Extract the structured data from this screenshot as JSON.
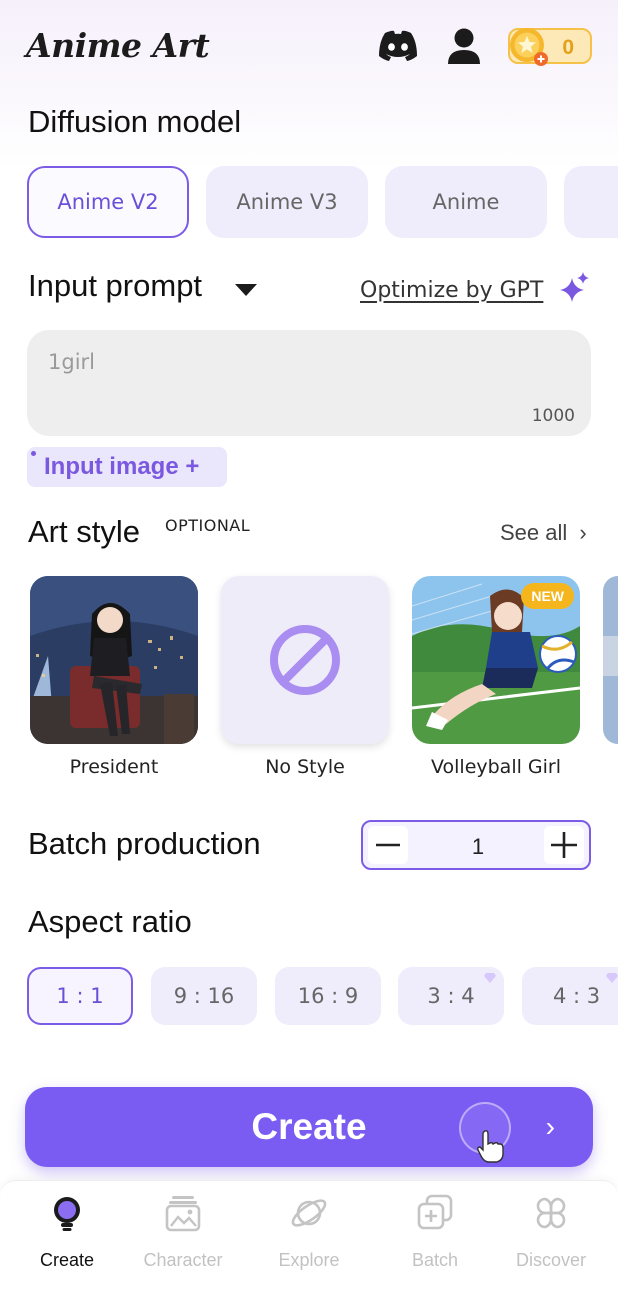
{
  "app": {
    "title": "Anime Art",
    "coins": "0"
  },
  "diffusion": {
    "title": "Diffusion model",
    "models": [
      {
        "label": "Anime V2",
        "selected": true
      },
      {
        "label": "Anime V3",
        "selected": false
      },
      {
        "label": "Anime",
        "selected": false
      }
    ]
  },
  "prompt": {
    "title": "Input prompt",
    "optimize_label": "Optimize by GPT",
    "placeholder": "1girl",
    "char_limit": "1000",
    "input_image_label": "Input image +"
  },
  "art_style": {
    "title": "Art style",
    "optional_label": "OPTIONAL",
    "see_all": "See all",
    "items": [
      {
        "label": "President"
      },
      {
        "label": "No Style"
      },
      {
        "label": "Volleyball Girl",
        "badge": "NEW"
      }
    ]
  },
  "batch": {
    "title": "Batch production",
    "value": "1",
    "minus": "−",
    "plus": "+"
  },
  "aspect": {
    "title": "Aspect ratio",
    "options": [
      {
        "label": "1 : 1",
        "selected": true
      },
      {
        "label": "9 : 16"
      },
      {
        "label": "16 : 9"
      },
      {
        "label": "3 : 4",
        "premium": true
      },
      {
        "label": "4 : 3",
        "premium": true
      }
    ]
  },
  "create": {
    "label": "Create",
    "chevron": "›"
  },
  "nav": {
    "items": [
      {
        "label": "Create",
        "active": true
      },
      {
        "label": "Character"
      },
      {
        "label": "Explore"
      },
      {
        "label": "Batch"
      },
      {
        "label": "Discover"
      }
    ]
  },
  "colors": {
    "accent": "#7b5cf2",
    "chip_bg": "#efecfb",
    "coin": "#f5b72c",
    "new_badge": "#f5b51d"
  },
  "icons": [
    "discord-icon",
    "profile-icon",
    "coin-icon",
    "caret-down-icon",
    "sparkle-icon",
    "chevron-right-icon",
    "no-style-icon",
    "minus-icon",
    "plus-icon",
    "gem-icon",
    "bulb-icon",
    "character-icon",
    "planet-icon",
    "batch-icon",
    "discover-icon"
  ]
}
